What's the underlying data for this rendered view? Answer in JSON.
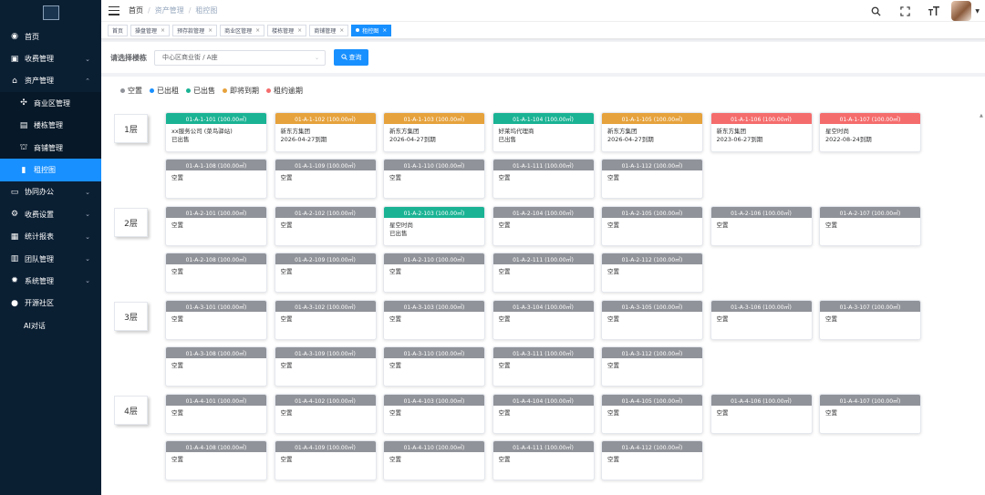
{
  "colors": {
    "empty": "#909399",
    "rented": "#1890ff",
    "sold": "#1ab394",
    "expiring": "#e6a23c",
    "overdue": "#f56c6c",
    "sidebar_bg": "#0b1f33",
    "active": "#1890ff"
  },
  "sidebar": {
    "items": [
      {
        "label": "首页",
        "icon": "dashboard-icon",
        "glyph": "◉",
        "arrow": ""
      },
      {
        "label": "收费管理",
        "icon": "money-icon",
        "glyph": "▣",
        "arrow": "⌄"
      },
      {
        "label": "资产管理",
        "icon": "home-icon",
        "glyph": "⌂",
        "arrow": "⌃"
      },
      {
        "label": "商业区管理",
        "icon": "compass-icon",
        "glyph": "✣",
        "arrow": "",
        "sub": true
      },
      {
        "label": "楼栋管理",
        "icon": "building-icon",
        "glyph": "▤",
        "arrow": "",
        "sub": true
      },
      {
        "label": "商铺管理",
        "icon": "shop-icon",
        "glyph": "⛫",
        "arrow": "",
        "sub": true
      },
      {
        "label": "租控图",
        "icon": "chart-icon",
        "glyph": "▮",
        "arrow": "",
        "sub": true,
        "active": true
      },
      {
        "label": "协同办公",
        "icon": "office-icon",
        "glyph": "▭",
        "arrow": "⌄"
      },
      {
        "label": "收费设置",
        "icon": "settings-icon",
        "glyph": "⚙",
        "arrow": "⌄"
      },
      {
        "label": "统计报表",
        "icon": "report-icon",
        "glyph": "▦",
        "arrow": "⌄"
      },
      {
        "label": "团队管理",
        "icon": "team-icon",
        "glyph": "▥",
        "arrow": "⌄"
      },
      {
        "label": "系统管理",
        "icon": "system-icon",
        "glyph": "✹",
        "arrow": "⌄"
      },
      {
        "label": "开源社区",
        "icon": "github-icon",
        "glyph": "●",
        "arrow": ""
      },
      {
        "label": "AI对话",
        "icon": "",
        "glyph": "",
        "arrow": ""
      }
    ]
  },
  "header": {
    "breadcrumb": [
      "首页",
      "资产管理",
      "租控图"
    ],
    "breadcrumb_sep": "/"
  },
  "tags": [
    {
      "label": "首页",
      "close": false
    },
    {
      "label": "操盘管理",
      "close": true
    },
    {
      "label": "预存款管理",
      "close": true
    },
    {
      "label": "商业区管理",
      "close": true
    },
    {
      "label": "楼栋管理",
      "close": true
    },
    {
      "label": "商铺管理",
      "close": true
    },
    {
      "label": "租控图",
      "close": true,
      "active": true
    }
  ],
  "filter": {
    "label": "请选择楼栋",
    "value": "中心区商业街 / A座",
    "button": "查询"
  },
  "legend": [
    {
      "label": "空置",
      "color": "#909399"
    },
    {
      "label": "已出租",
      "color": "#1890ff"
    },
    {
      "label": "已出售",
      "color": "#1ab394"
    },
    {
      "label": "即将到期",
      "color": "#e6a23c"
    },
    {
      "label": "租约逾期",
      "color": "#f56c6c"
    }
  ],
  "floors": [
    {
      "name": "1层",
      "rooms": [
        {
          "code": "01-A-1-101 (100.00㎡)",
          "status": "sold",
          "lines": [
            "xx服务公司 (菜鸟驿站)",
            "已出售"
          ]
        },
        {
          "code": "01-A-1-102 (100.00㎡)",
          "status": "expiring",
          "lines": [
            "新东方集团",
            "2026-04-27到期"
          ]
        },
        {
          "code": "01-A-1-103 (100.00㎡)",
          "status": "expiring",
          "lines": [
            "新东方集团",
            "2026-04-27到期"
          ]
        },
        {
          "code": "01-A-1-104 (100.00㎡)",
          "status": "sold",
          "lines": [
            "好莱坞代理商",
            "已出售"
          ]
        },
        {
          "code": "01-A-1-105 (100.00㎡)",
          "status": "expiring",
          "lines": [
            "新东方集团",
            "2026-04-27到期"
          ]
        },
        {
          "code": "01-A-1-106 (100.00㎡)",
          "status": "overdue",
          "lines": [
            "新东方集团",
            "2023-06-27到期"
          ]
        },
        {
          "code": "01-A-1-107 (100.00㎡)",
          "status": "overdue",
          "lines": [
            "星空时尚",
            "2022-08-24到期"
          ]
        },
        {
          "code": "01-A-1-108 (100.00㎡)",
          "status": "empty",
          "lines": [
            "空置"
          ]
        },
        {
          "code": "01-A-1-109 (100.00㎡)",
          "status": "empty",
          "lines": [
            "空置"
          ]
        },
        {
          "code": "01-A-1-110 (100.00㎡)",
          "status": "empty",
          "lines": [
            "空置"
          ]
        },
        {
          "code": "01-A-1-111 (100.00㎡)",
          "status": "empty",
          "lines": [
            "空置"
          ]
        },
        {
          "code": "01-A-1-112 (100.00㎡)",
          "status": "empty",
          "lines": [
            "空置"
          ]
        }
      ]
    },
    {
      "name": "2层",
      "rooms": [
        {
          "code": "01-A-2-101 (100.00㎡)",
          "status": "empty",
          "lines": [
            "空置"
          ]
        },
        {
          "code": "01-A-2-102 (100.00㎡)",
          "status": "empty",
          "lines": [
            "空置"
          ]
        },
        {
          "code": "01-A-2-103 (100.00㎡)",
          "status": "sold",
          "lines": [
            "星空时尚",
            "已出售"
          ]
        },
        {
          "code": "01-A-2-104 (100.00㎡)",
          "status": "empty",
          "lines": [
            "空置"
          ]
        },
        {
          "code": "01-A-2-105 (100.00㎡)",
          "status": "empty",
          "lines": [
            "空置"
          ]
        },
        {
          "code": "01-A-2-106 (100.00㎡)",
          "status": "empty",
          "lines": [
            "空置"
          ]
        },
        {
          "code": "01-A-2-107 (100.00㎡)",
          "status": "empty",
          "lines": [
            "空置"
          ]
        },
        {
          "code": "01-A-2-108 (100.00㎡)",
          "status": "empty",
          "lines": [
            "空置"
          ]
        },
        {
          "code": "01-A-2-109 (100.00㎡)",
          "status": "empty",
          "lines": [
            "空置"
          ]
        },
        {
          "code": "01-A-2-110 (100.00㎡)",
          "status": "empty",
          "lines": [
            "空置"
          ]
        },
        {
          "code": "01-A-2-111 (100.00㎡)",
          "status": "empty",
          "lines": [
            "空置"
          ]
        },
        {
          "code": "01-A-2-112 (100.00㎡)",
          "status": "empty",
          "lines": [
            "空置"
          ]
        }
      ]
    },
    {
      "name": "3层",
      "rooms": [
        {
          "code": "01-A-3-101 (100.00㎡)",
          "status": "empty",
          "lines": [
            "空置"
          ]
        },
        {
          "code": "01-A-3-102 (100.00㎡)",
          "status": "empty",
          "lines": [
            "空置"
          ]
        },
        {
          "code": "01-A-3-103 (100.00㎡)",
          "status": "empty",
          "lines": [
            "空置"
          ]
        },
        {
          "code": "01-A-3-104 (100.00㎡)",
          "status": "empty",
          "lines": [
            "空置"
          ]
        },
        {
          "code": "01-A-3-105 (100.00㎡)",
          "status": "empty",
          "lines": [
            "空置"
          ]
        },
        {
          "code": "01-A-3-106 (100.00㎡)",
          "status": "empty",
          "lines": [
            "空置"
          ]
        },
        {
          "code": "01-A-3-107 (100.00㎡)",
          "status": "empty",
          "lines": [
            "空置"
          ]
        },
        {
          "code": "01-A-3-108 (100.00㎡)",
          "status": "empty",
          "lines": [
            "空置"
          ]
        },
        {
          "code": "01-A-3-109 (100.00㎡)",
          "status": "empty",
          "lines": [
            "空置"
          ]
        },
        {
          "code": "01-A-3-110 (100.00㎡)",
          "status": "empty",
          "lines": [
            "空置"
          ]
        },
        {
          "code": "01-A-3-111 (100.00㎡)",
          "status": "empty",
          "lines": [
            "空置"
          ]
        },
        {
          "code": "01-A-3-112 (100.00㎡)",
          "status": "empty",
          "lines": [
            "空置"
          ]
        }
      ]
    },
    {
      "name": "4层",
      "rooms": [
        {
          "code": "01-A-4-101 (100.00㎡)",
          "status": "empty",
          "lines": [
            "空置"
          ]
        },
        {
          "code": "01-A-4-102 (100.00㎡)",
          "status": "empty",
          "lines": [
            "空置"
          ]
        },
        {
          "code": "01-A-4-103 (100.00㎡)",
          "status": "empty",
          "lines": [
            "空置"
          ]
        },
        {
          "code": "01-A-4-104 (100.00㎡)",
          "status": "empty",
          "lines": [
            "空置"
          ]
        },
        {
          "code": "01-A-4-105 (100.00㎡)",
          "status": "empty",
          "lines": [
            "空置"
          ]
        },
        {
          "code": "01-A-4-106 (100.00㎡)",
          "status": "empty",
          "lines": [
            "空置"
          ]
        },
        {
          "code": "01-A-4-107 (100.00㎡)",
          "status": "empty",
          "lines": [
            "空置"
          ]
        },
        {
          "code": "01-A-4-108 (100.00㎡)",
          "status": "empty",
          "lines": [
            "空置"
          ]
        },
        {
          "code": "01-A-4-109 (100.00㎡)",
          "status": "empty",
          "lines": [
            "空置"
          ]
        },
        {
          "code": "01-A-4-110 (100.00㎡)",
          "status": "empty",
          "lines": [
            "空置"
          ]
        },
        {
          "code": "01-A-4-111 (100.00㎡)",
          "status": "empty",
          "lines": [
            "空置"
          ]
        },
        {
          "code": "01-A-4-112 (100.00㎡)",
          "status": "empty",
          "lines": [
            "空置"
          ]
        }
      ]
    }
  ]
}
